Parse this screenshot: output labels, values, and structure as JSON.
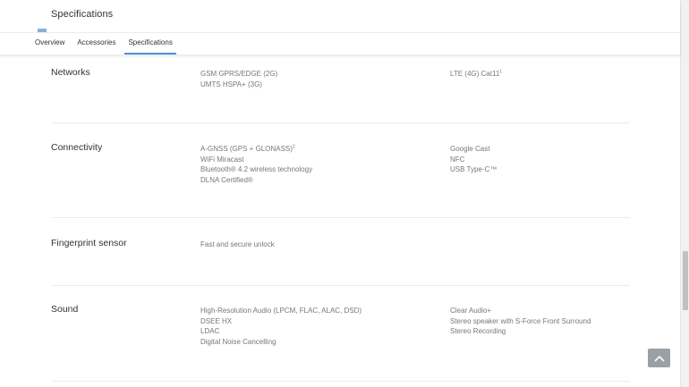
{
  "header": {
    "title": "Specifications",
    "tabs": [
      {
        "label": "Overview",
        "active": false
      },
      {
        "label": "Accessories",
        "active": false
      },
      {
        "label": "Specifications",
        "active": true
      }
    ]
  },
  "sections": [
    {
      "title": "Networks",
      "left": [
        "GSM GPRS/EDGE (2G)",
        "UMTS HSPA+ (3G)"
      ],
      "right": [
        "LTE (4G) Cat11"
      ],
      "right_sup": [
        "1"
      ]
    },
    {
      "title": "Connectivity",
      "left": [
        "A-GNSS (GPS + GLONASS)",
        "WiFi Miracast",
        "Bluetooth® 4.2 wireless technology",
        "DLNA Certified®"
      ],
      "left_sup": [
        "2"
      ],
      "right": [
        "Google Cast",
        "NFC",
        "USB Type-C™"
      ]
    },
    {
      "title": "Fingerprint sensor",
      "left": [
        "Fast and secure unlock"
      ],
      "right": []
    },
    {
      "title": "Sound",
      "left": [
        "High-Resolution Audio (LPCM, FLAC, ALAC, DSD)",
        "DSEE HX",
        "LDAC",
        "Digital Noise Cancelling"
      ],
      "right": [
        "Clear Audio+",
        "Stereo speaker with S-Force Front Surround",
        "Stereo Recording"
      ]
    }
  ],
  "colors": {
    "tab_underline": "#4a90d9",
    "title_accent": "#8ab0d9",
    "back_to_top_bg": "#9aa0a6"
  },
  "icons": {
    "back_to_top": "chevron-up-icon"
  }
}
